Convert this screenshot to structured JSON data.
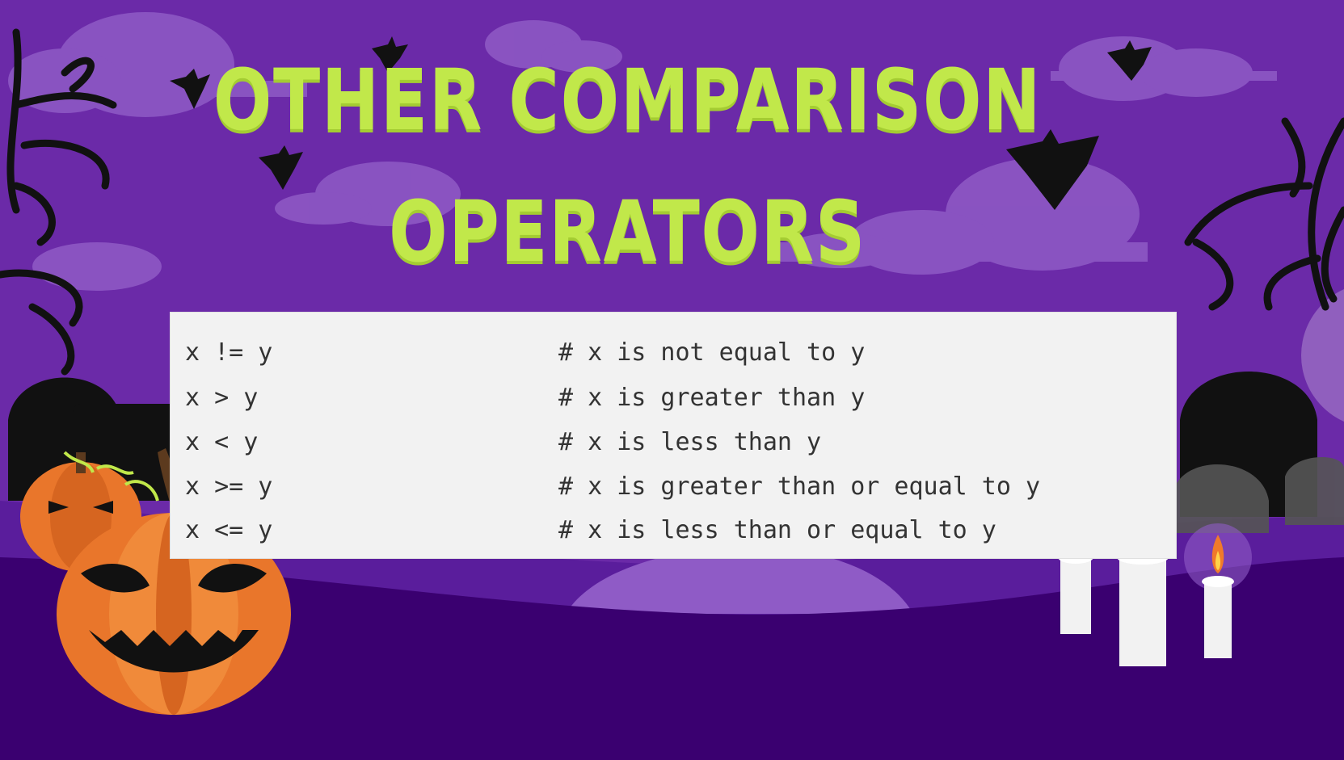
{
  "slide": {
    "title_lines": [
      "Other Comparison",
      "Operators"
    ],
    "code_rows": [
      {
        "expr": "x != y",
        "comment": "# x is not equal to y"
      },
      {
        "expr": "x > y",
        "comment": "# x is greater than y"
      },
      {
        "expr": "x < y",
        "comment": "# x is less than y"
      },
      {
        "expr": "x >= y",
        "comment": "# x is greater than or equal to y"
      },
      {
        "expr": "x <= y",
        "comment": "# x is less than or equal to y"
      }
    ]
  },
  "colors": {
    "background_purple": "#6b2aa8",
    "ground_purple": "#3a0070",
    "hill_purple": "#5a1d9c",
    "cloud_purple": "#8f5bc6",
    "title_green": "#c1e84a",
    "pumpkin_orange": "#e9762b",
    "code_background": "#f2f2f2"
  },
  "decorations": {
    "icons": [
      "bat-icon",
      "cloud-icon",
      "tree-icon",
      "pumpkin-icon",
      "candle-icon",
      "tombstone-icon"
    ]
  }
}
